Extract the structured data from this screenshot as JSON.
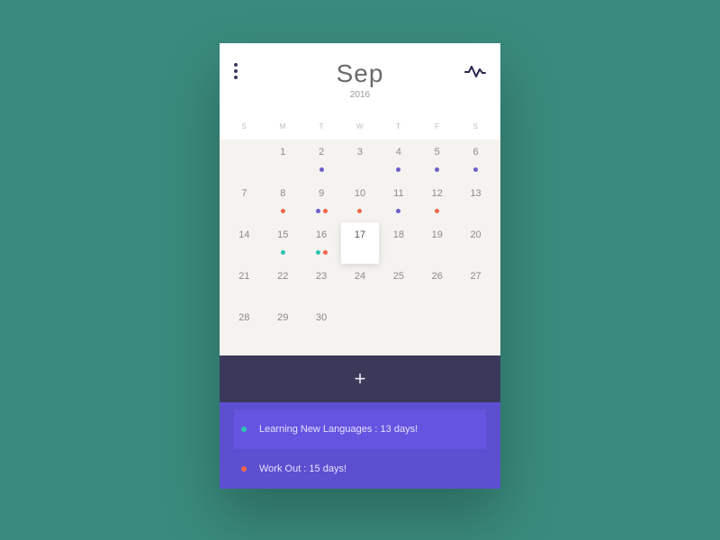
{
  "header": {
    "month": "Sep",
    "year": "2016"
  },
  "weekdays": [
    "S",
    "M",
    "T",
    "W",
    "T",
    "F",
    "S"
  ],
  "colors": {
    "purple": "#6b5fc7",
    "orange": "#f2654a",
    "teal": "#2bc4b0"
  },
  "selectedDay": 17,
  "days": [
    {
      "n": null
    },
    {
      "n": 1
    },
    {
      "n": 2,
      "dots": [
        "purple"
      ]
    },
    {
      "n": 3
    },
    {
      "n": 4,
      "dots": [
        "purple"
      ]
    },
    {
      "n": 5,
      "dots": [
        "purple"
      ]
    },
    {
      "n": 6,
      "dots": [
        "purple"
      ]
    },
    {
      "n": 7
    },
    {
      "n": 8,
      "dots": [
        "orange"
      ]
    },
    {
      "n": 9,
      "dots": [
        "purple",
        "orange"
      ]
    },
    {
      "n": 10,
      "dots": [
        "orange"
      ]
    },
    {
      "n": 11,
      "dots": [
        "purple"
      ]
    },
    {
      "n": 12,
      "dots": [
        "orange"
      ]
    },
    {
      "n": 13
    },
    {
      "n": 14
    },
    {
      "n": 15,
      "dots": [
        "teal"
      ]
    },
    {
      "n": 16,
      "dots": [
        "teal",
        "orange"
      ]
    },
    {
      "n": 17
    },
    {
      "n": 18
    },
    {
      "n": 19
    },
    {
      "n": 20
    },
    {
      "n": 21
    },
    {
      "n": 22
    },
    {
      "n": 23
    },
    {
      "n": 24
    },
    {
      "n": 25
    },
    {
      "n": 26
    },
    {
      "n": 27
    },
    {
      "n": 28
    },
    {
      "n": 29
    },
    {
      "n": 30
    }
  ],
  "events": [
    {
      "color": "teal",
      "text": "Learning New Languages : 13 days!",
      "highlight": true
    },
    {
      "color": "orange",
      "text": "Work Out : 15 days!",
      "highlight": false
    }
  ]
}
